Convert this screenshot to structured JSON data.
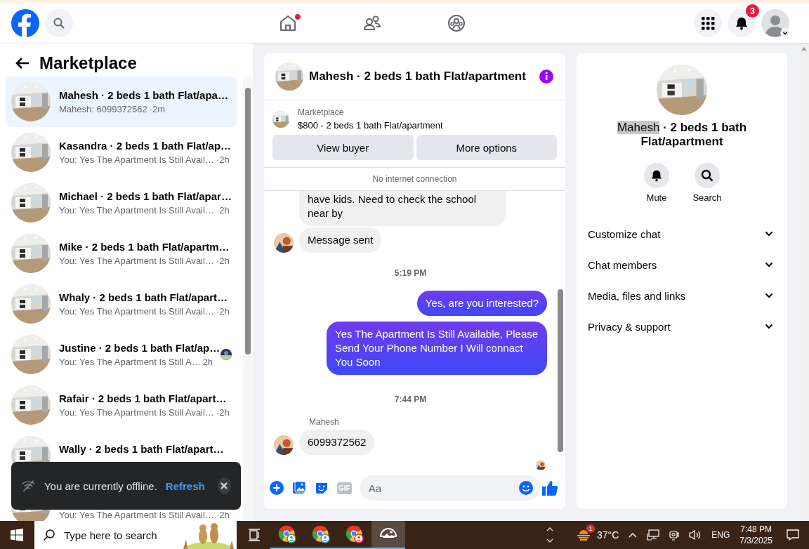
{
  "top_bar": {
    "notification_count": "3",
    "nav": [
      {
        "dot": true
      },
      {
        "dot": false
      },
      {
        "dot": false
      }
    ]
  },
  "sidebar": {
    "title": "Marketplace",
    "conversations": [
      {
        "name": "Mahesh · 2 beds 1 bath Flat/apa…",
        "preview": "Mahesh: 6099372562",
        "time": "·2m",
        "selected": true,
        "seen": false
      },
      {
        "name": "Kasandra · 2 beds 1 bath Flat/ap…",
        "preview": "You: Yes The Apartment Is Still Avail…",
        "time": "·2h",
        "selected": false,
        "seen": false
      },
      {
        "name": "Michael · 2 beds 1 bath Flat/apar…",
        "preview": "You: Yes The Apartment Is Still Avail…",
        "time": "·2h",
        "selected": false,
        "seen": false
      },
      {
        "name": "Mike · 2 beds 1 bath Flat/apartm…",
        "preview": "You: Yes The Apartment Is Still Avail…",
        "time": "·2h",
        "selected": false,
        "seen": false
      },
      {
        "name": "Whaly · 2 beds 1 bath Flat/apart…",
        "preview": "You: Yes The Apartment Is Still Avail…",
        "time": "·2h",
        "selected": false,
        "seen": false
      },
      {
        "name": "Justine · 2 beds 1 bath Flat/ap…",
        "preview": "You: Yes The Apartment Is Still A…",
        "time": "2h",
        "selected": false,
        "seen": true
      },
      {
        "name": "Rafair · 2 beds 1 bath Flat/apart…",
        "preview": "You: Yes The Apartment Is Still Avail…",
        "time": "·2h",
        "selected": false,
        "seen": false
      },
      {
        "name": "Wally · 2 beds 1 bath Flat/apart…",
        "selected": false,
        "seen": false
      },
      {
        "preview": "You: Yes The Apartment Is Still Avail…",
        "time": "·2h",
        "selected": false,
        "seen": false
      }
    ]
  },
  "toast": {
    "text": "You are currently offline.",
    "action": "Refresh"
  },
  "chat": {
    "title": "Mahesh · 2 beds 1 bath Flat/apartment",
    "listing": {
      "source": "Marketplace",
      "title": "$800 - 2 beds 1 bath Flat/apartment"
    },
    "buttons": [
      "View buyer",
      "More options"
    ],
    "notice": "No internet connection",
    "messages": [
      {
        "kind": "incoming",
        "text": "have kids. Need to check the school near by",
        "avatar": false
      },
      {
        "kind": "incoming",
        "text": "Message sent",
        "avatar": true
      },
      {
        "kind": "time",
        "text": "5:19 PM"
      },
      {
        "kind": "outgoing",
        "text": "Yes, are you interested?"
      },
      {
        "kind": "outgoing",
        "text": "Yes The Apartment Is Still Available, Please Send Your Phone Number I Will connact You Soon"
      },
      {
        "kind": "time",
        "text": "7:44 PM"
      },
      {
        "kind": "sender",
        "text": "Mahesh"
      },
      {
        "kind": "incoming",
        "text": "6099372562",
        "avatar": true
      },
      {
        "kind": "seen"
      }
    ],
    "composer": {
      "placeholder": "Aa",
      "gif": "GIF"
    }
  },
  "details": {
    "name": {
      "highlighted": "Mahesh",
      "rest": " · 2 beds 1 bath Flat/apartment"
    },
    "actions": [
      "Mute",
      "Search"
    ],
    "sections": [
      {
        "label": "Customize chat",
        "expanded": false
      },
      {
        "label": "Chat members",
        "expanded": false
      },
      {
        "label": "Media, files and links",
        "expanded": false
      },
      {
        "label": "Privacy & support",
        "expanded": false
      }
    ]
  },
  "taskbar": {
    "search_placeholder": "Type here to search",
    "apps": [
      {
        "kind": "browser",
        "selected": false
      },
      {
        "kind": "browser",
        "selected": false
      },
      {
        "kind": "browser",
        "selected": false
      },
      {
        "kind": "photos",
        "selected": true
      }
    ],
    "weather_badge": "1",
    "temperature": "37°C",
    "language": "ENG",
    "time": "7:48 PM",
    "date": "7/3/2025"
  }
}
